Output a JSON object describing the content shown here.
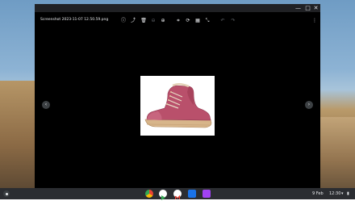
{
  "window": {
    "minimize_icon": "minimize-icon",
    "maximize_icon": "maximize-icon",
    "close_icon": "close-icon",
    "min_glyph": "—",
    "max_glyph": "□",
    "close_glyph": "✕"
  },
  "viewer": {
    "filename": "Screenshot 2023-11-07 12.50.59.png",
    "toolbar": [
      {
        "name": "info-icon",
        "glyph": "ⓘ"
      },
      {
        "name": "share-icon",
        "glyph": "⤴"
      },
      {
        "name": "delete-icon",
        "glyph": "🗑"
      },
      {
        "name": "zoom-out-icon",
        "glyph": "⊖"
      },
      {
        "name": "zoom-in-icon",
        "glyph": "⊕"
      },
      {
        "name": "crop-icon",
        "glyph": "⌗"
      },
      {
        "name": "rotate-icon",
        "glyph": "⟳"
      },
      {
        "name": "filter-icon",
        "glyph": "▦"
      },
      {
        "name": "rescale-icon",
        "glyph": "⤡"
      },
      {
        "name": "undo-icon",
        "glyph": "↶"
      },
      {
        "name": "redo-icon",
        "glyph": "↷"
      },
      {
        "name": "more-icon",
        "glyph": "⋮"
      }
    ],
    "prev_glyph": "‹",
    "next_glyph": "›"
  },
  "shelf": {
    "apps": [
      {
        "name": "chrome-icon",
        "color": "#ea4335"
      },
      {
        "name": "play-store-icon",
        "color": "#ffffff"
      },
      {
        "name": "gmail-icon",
        "color": "#ffffff"
      },
      {
        "name": "files-icon",
        "color": "#1a73e8"
      },
      {
        "name": "gallery-icon",
        "color": "#a142f4"
      }
    ],
    "notification": "9 Feb",
    "time": "12:30"
  }
}
